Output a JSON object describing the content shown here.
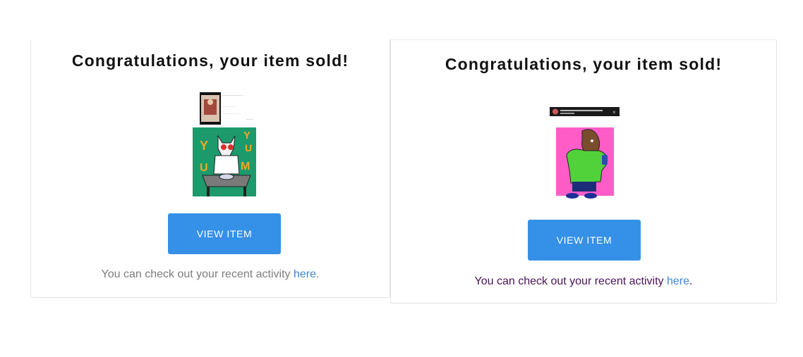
{
  "cards": [
    {
      "title": "Congratulations, your item sold!",
      "artwork": {
        "icon": "yum-artwork-image",
        "text_letters": [
          "Y",
          "U",
          "Y",
          "U",
          "M"
        ]
      },
      "button_label": "VIEW ITEM",
      "activity_text": "You can check out your recent activity ",
      "activity_link": "here",
      "activity_end": "."
    },
    {
      "title": "Congratulations, your item sold!",
      "artwork": {
        "icon": "hoodie-character-artwork-image"
      },
      "button_label": "VIEW ITEM",
      "activity_text": "You can check out your recent activity ",
      "activity_link": "here",
      "activity_end": "."
    }
  ],
  "colors": {
    "button": "#3590e8",
    "link": "#3c87d8",
    "activity_text_card1": "#7d7d7d",
    "activity_text_card2": "#4a1358"
  }
}
